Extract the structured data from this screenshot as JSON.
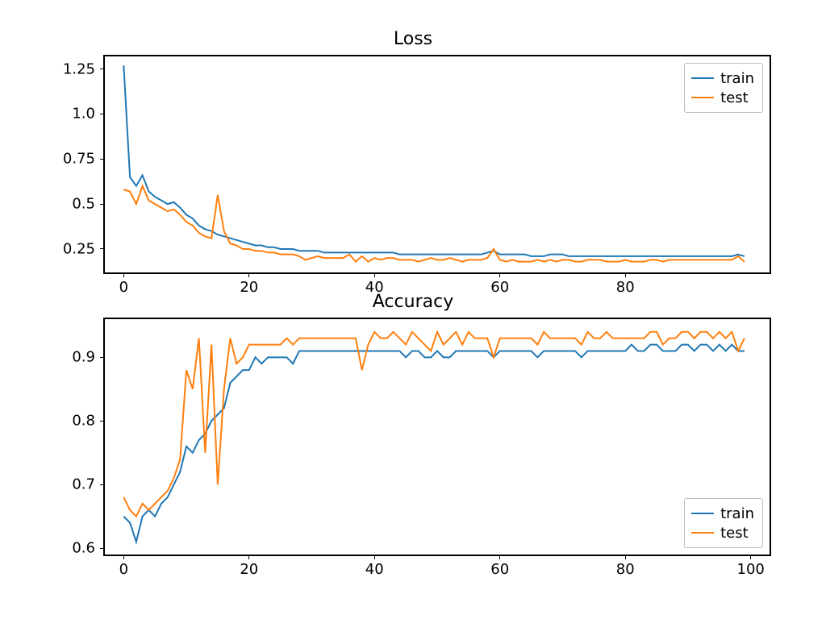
{
  "colors": {
    "train": "#1f77b4",
    "test": "#ff7f0e"
  },
  "legend": {
    "train": "train",
    "test": "test"
  },
  "chart_data": [
    {
      "type": "line",
      "title": "Loss",
      "xlabel": "",
      "ylabel": "",
      "xlim": [
        -3,
        103
      ],
      "ylim": [
        0.12,
        1.32
      ],
      "xticks": [
        0,
        20,
        40,
        60,
        80
      ],
      "yticks": [
        0.25,
        0.5,
        0.75,
        1.0,
        1.25
      ],
      "legend_position": "upper right",
      "x": [
        0,
        1,
        2,
        3,
        4,
        5,
        6,
        7,
        8,
        9,
        10,
        11,
        12,
        13,
        14,
        15,
        16,
        17,
        18,
        19,
        20,
        21,
        22,
        23,
        24,
        25,
        26,
        27,
        28,
        29,
        30,
        31,
        32,
        33,
        34,
        35,
        36,
        37,
        38,
        39,
        40,
        41,
        42,
        43,
        44,
        45,
        46,
        47,
        48,
        49,
        50,
        51,
        52,
        53,
        54,
        55,
        56,
        57,
        58,
        59,
        60,
        61,
        62,
        63,
        64,
        65,
        66,
        67,
        68,
        69,
        70,
        71,
        72,
        73,
        74,
        75,
        76,
        77,
        78,
        79,
        80,
        81,
        82,
        83,
        84,
        85,
        86,
        87,
        88,
        89,
        90,
        91,
        92,
        93,
        94,
        95,
        96,
        97,
        98,
        99
      ],
      "series": [
        {
          "name": "train",
          "values": [
            1.27,
            0.65,
            0.6,
            0.66,
            0.57,
            0.54,
            0.52,
            0.5,
            0.51,
            0.48,
            0.44,
            0.42,
            0.38,
            0.36,
            0.35,
            0.33,
            0.32,
            0.31,
            0.3,
            0.29,
            0.28,
            0.27,
            0.27,
            0.26,
            0.26,
            0.25,
            0.25,
            0.25,
            0.24,
            0.24,
            0.24,
            0.24,
            0.23,
            0.23,
            0.23,
            0.23,
            0.23,
            0.23,
            0.23,
            0.23,
            0.23,
            0.23,
            0.23,
            0.23,
            0.22,
            0.22,
            0.22,
            0.22,
            0.22,
            0.22,
            0.22,
            0.22,
            0.22,
            0.22,
            0.22,
            0.22,
            0.22,
            0.22,
            0.23,
            0.24,
            0.22,
            0.22,
            0.22,
            0.22,
            0.22,
            0.21,
            0.21,
            0.21,
            0.22,
            0.22,
            0.22,
            0.21,
            0.21,
            0.21,
            0.21,
            0.21,
            0.21,
            0.21,
            0.21,
            0.21,
            0.21,
            0.21,
            0.21,
            0.21,
            0.21,
            0.21,
            0.21,
            0.21,
            0.21,
            0.21,
            0.21,
            0.21,
            0.21,
            0.21,
            0.21,
            0.21,
            0.21,
            0.21,
            0.22,
            0.21
          ]
        },
        {
          "name": "test",
          "values": [
            0.58,
            0.57,
            0.5,
            0.6,
            0.52,
            0.5,
            0.48,
            0.46,
            0.47,
            0.44,
            0.4,
            0.38,
            0.34,
            0.32,
            0.31,
            0.55,
            0.35,
            0.28,
            0.27,
            0.25,
            0.25,
            0.24,
            0.24,
            0.23,
            0.23,
            0.22,
            0.22,
            0.22,
            0.21,
            0.19,
            0.2,
            0.21,
            0.2,
            0.2,
            0.2,
            0.2,
            0.22,
            0.18,
            0.21,
            0.18,
            0.2,
            0.19,
            0.2,
            0.2,
            0.19,
            0.19,
            0.19,
            0.18,
            0.19,
            0.2,
            0.19,
            0.19,
            0.2,
            0.19,
            0.18,
            0.19,
            0.19,
            0.19,
            0.2,
            0.25,
            0.19,
            0.18,
            0.19,
            0.18,
            0.18,
            0.18,
            0.19,
            0.18,
            0.19,
            0.18,
            0.19,
            0.19,
            0.18,
            0.18,
            0.19,
            0.19,
            0.19,
            0.18,
            0.18,
            0.18,
            0.19,
            0.18,
            0.18,
            0.18,
            0.19,
            0.19,
            0.18,
            0.19,
            0.19,
            0.19,
            0.19,
            0.19,
            0.19,
            0.19,
            0.19,
            0.19,
            0.19,
            0.19,
            0.21,
            0.18
          ]
        }
      ]
    },
    {
      "type": "line",
      "title": "Accuracy",
      "xlabel": "",
      "ylabel": "",
      "xlim": [
        -3,
        103
      ],
      "ylim": [
        0.59,
        0.96
      ],
      "xticks": [
        0,
        20,
        40,
        60,
        80,
        100
      ],
      "yticks": [
        0.6,
        0.7,
        0.8,
        0.9
      ],
      "legend_position": "lower right",
      "x": [
        0,
        1,
        2,
        3,
        4,
        5,
        6,
        7,
        8,
        9,
        10,
        11,
        12,
        13,
        14,
        15,
        16,
        17,
        18,
        19,
        20,
        21,
        22,
        23,
        24,
        25,
        26,
        27,
        28,
        29,
        30,
        31,
        32,
        33,
        34,
        35,
        36,
        37,
        38,
        39,
        40,
        41,
        42,
        43,
        44,
        45,
        46,
        47,
        48,
        49,
        50,
        51,
        52,
        53,
        54,
        55,
        56,
        57,
        58,
        59,
        60,
        61,
        62,
        63,
        64,
        65,
        66,
        67,
        68,
        69,
        70,
        71,
        72,
        73,
        74,
        75,
        76,
        77,
        78,
        79,
        80,
        81,
        82,
        83,
        84,
        85,
        86,
        87,
        88,
        89,
        90,
        91,
        92,
        93,
        94,
        95,
        96,
        97,
        98,
        99
      ],
      "series": [
        {
          "name": "train",
          "values": [
            0.65,
            0.64,
            0.61,
            0.65,
            0.66,
            0.65,
            0.67,
            0.68,
            0.7,
            0.72,
            0.76,
            0.75,
            0.77,
            0.78,
            0.8,
            0.81,
            0.82,
            0.86,
            0.87,
            0.88,
            0.88,
            0.9,
            0.89,
            0.9,
            0.9,
            0.9,
            0.9,
            0.89,
            0.91,
            0.91,
            0.91,
            0.91,
            0.91,
            0.91,
            0.91,
            0.91,
            0.91,
            0.91,
            0.91,
            0.91,
            0.91,
            0.91,
            0.91,
            0.91,
            0.91,
            0.9,
            0.91,
            0.91,
            0.9,
            0.9,
            0.91,
            0.9,
            0.9,
            0.91,
            0.91,
            0.91,
            0.91,
            0.91,
            0.91,
            0.9,
            0.91,
            0.91,
            0.91,
            0.91,
            0.91,
            0.91,
            0.9,
            0.91,
            0.91,
            0.91,
            0.91,
            0.91,
            0.91,
            0.9,
            0.91,
            0.91,
            0.91,
            0.91,
            0.91,
            0.91,
            0.91,
            0.92,
            0.91,
            0.91,
            0.92,
            0.92,
            0.91,
            0.91,
            0.91,
            0.92,
            0.92,
            0.91,
            0.92,
            0.92,
            0.91,
            0.92,
            0.91,
            0.92,
            0.91,
            0.91
          ]
        },
        {
          "name": "test",
          "values": [
            0.68,
            0.66,
            0.65,
            0.67,
            0.66,
            0.67,
            0.68,
            0.69,
            0.71,
            0.74,
            0.88,
            0.85,
            0.93,
            0.75,
            0.92,
            0.7,
            0.85,
            0.93,
            0.89,
            0.9,
            0.92,
            0.92,
            0.92,
            0.92,
            0.92,
            0.92,
            0.93,
            0.92,
            0.93,
            0.93,
            0.93,
            0.93,
            0.93,
            0.93,
            0.93,
            0.93,
            0.93,
            0.93,
            0.88,
            0.92,
            0.94,
            0.93,
            0.93,
            0.94,
            0.93,
            0.92,
            0.94,
            0.93,
            0.92,
            0.91,
            0.94,
            0.92,
            0.93,
            0.94,
            0.92,
            0.94,
            0.93,
            0.93,
            0.93,
            0.9,
            0.93,
            0.93,
            0.93,
            0.93,
            0.93,
            0.93,
            0.92,
            0.94,
            0.93,
            0.93,
            0.93,
            0.93,
            0.93,
            0.92,
            0.94,
            0.93,
            0.93,
            0.94,
            0.93,
            0.93,
            0.93,
            0.93,
            0.93,
            0.93,
            0.94,
            0.94,
            0.92,
            0.93,
            0.93,
            0.94,
            0.94,
            0.93,
            0.94,
            0.94,
            0.93,
            0.94,
            0.93,
            0.94,
            0.91,
            0.93
          ]
        }
      ]
    }
  ]
}
